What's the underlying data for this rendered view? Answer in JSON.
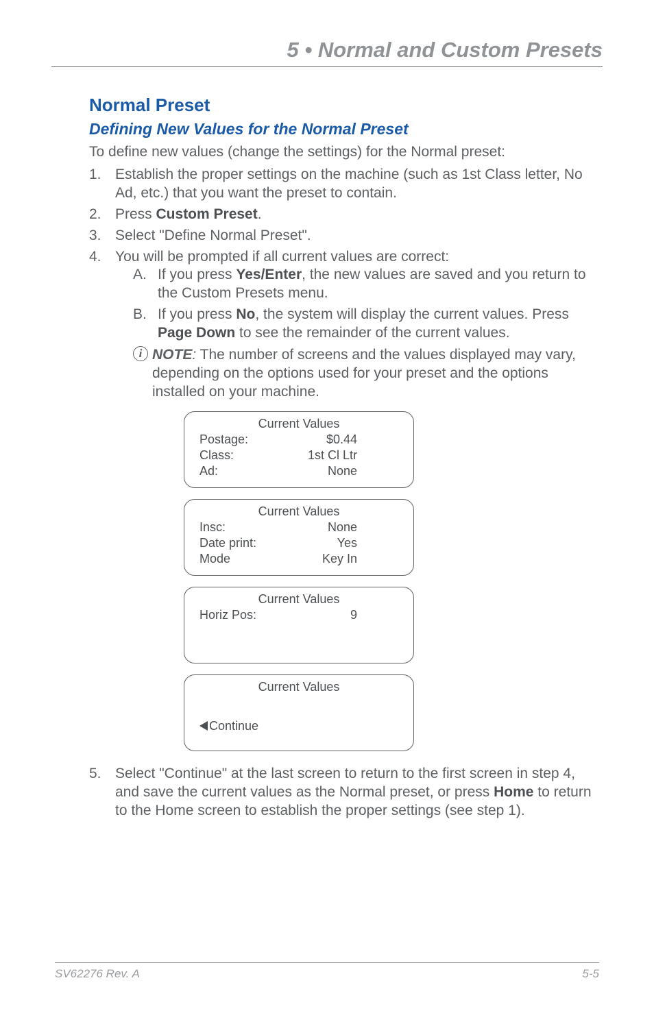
{
  "chapter": {
    "title": "5 • Normal and Custom Presets"
  },
  "section": {
    "title": "Normal Preset"
  },
  "subsection": {
    "title": "Defining New Values for the Normal Preset"
  },
  "intro": "To define new values (change the settings) for the Normal preset:",
  "steps": {
    "1": {
      "num": "1.",
      "text_a": "Establish the proper settings on the machine (such as 1st Class letter, No Ad, etc.) that you want the preset to contain."
    },
    "2": {
      "num": "2.",
      "pre": "Press ",
      "bold": "Custom Preset",
      "post": "."
    },
    "3": {
      "num": "3.",
      "text": "Select \"Define Normal Preset\"."
    },
    "4": {
      "num": "4.",
      "text": "You will be prompted if all current values are correct:"
    },
    "5": {
      "num": "5.",
      "pre": "Select \"Continue\" at the last screen to return to the first screen in step 4, and save the current values as the Normal preset, or press ",
      "bold": "Home",
      "post": " to return to the Home screen to establish the proper settings (see step 1)."
    }
  },
  "substeps": {
    "A": {
      "alpha": "A.",
      "pre": "If you press ",
      "bold": "Yes/Enter",
      "post": ", the new values are saved and you return to the Custom Presets menu."
    },
    "B": {
      "alpha": "B.",
      "pre": "If you press ",
      "bold1": "No",
      "mid": ", the system will display the current values. Press ",
      "bold2": "Page Down",
      "post": " to see the remainder of the current values."
    }
  },
  "note": {
    "label": "NOTE",
    "sep": ":",
    "text": " The number of screens and the values displayed may vary, depending on the options used for your preset and the options installed on your machine."
  },
  "screens": {
    "header": "Current Values",
    "s1": {
      "r1l": "Postage:",
      "r1v": "$0.44",
      "r2l": "Class:",
      "r2v": "1st Cl Ltr",
      "r3l": "Ad:",
      "r3v": "None"
    },
    "s2": {
      "r1l": "Insc:",
      "r1v": "None",
      "r2l": "Date print:",
      "r2v": "Yes",
      "r3l": "Mode",
      "r3v": "Key In"
    },
    "s3": {
      "r1l": "Horiz Pos:",
      "r1v": "9"
    },
    "s4": {
      "continue": "Continue"
    }
  },
  "footer": {
    "left": "SV62276 Rev. A",
    "right": "5-5"
  },
  "icons": {
    "info": "i"
  }
}
